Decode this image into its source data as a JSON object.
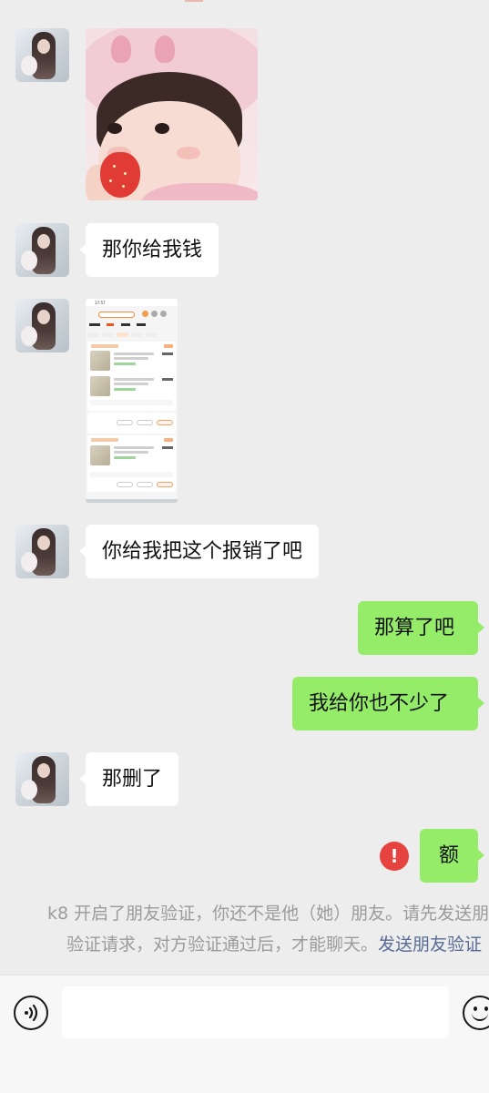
{
  "messages": [
    {
      "side": "left",
      "type": "image",
      "content": "baby-eating-strawberry-photo"
    },
    {
      "side": "left",
      "type": "text",
      "text": "那你给我钱"
    },
    {
      "side": "left",
      "type": "image",
      "content": "order-list-screenshot",
      "status_time": "17:57"
    },
    {
      "side": "left",
      "type": "text",
      "text": "你给我把这个报销了吧"
    },
    {
      "side": "right",
      "type": "text",
      "text": "那算了吧"
    },
    {
      "side": "right",
      "type": "text",
      "text": "我给你也不少了"
    },
    {
      "side": "left",
      "type": "text",
      "text": "那删了"
    },
    {
      "side": "right",
      "type": "text",
      "text": "额",
      "send_failed": true
    }
  ],
  "system_notice": {
    "line1": "k8 开启了朋友验证，你还不是他（她）朋友。请先发送朋",
    "line2": "验证请求，对方验证通过后，才能聊天。",
    "link": "发送朋友验证"
  },
  "error_icon": "!",
  "input": {
    "value": "",
    "placeholder": ""
  },
  "icons": [
    "voice-icon",
    "mic-icon",
    "emoji-icon"
  ],
  "colors": {
    "background": "#ededed",
    "sent_bubble": "#95ec69",
    "received_bubble": "#ffffff",
    "link": "#576b95",
    "error": "#e64340"
  }
}
